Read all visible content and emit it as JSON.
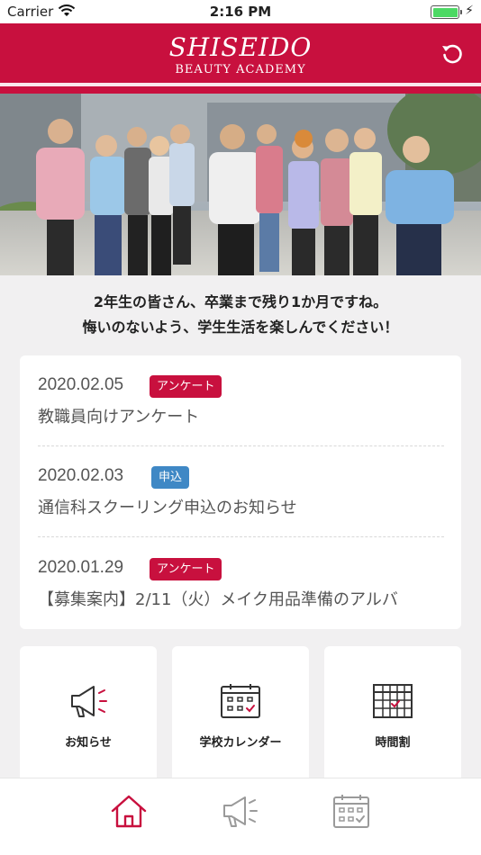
{
  "status_bar": {
    "carrier": "Carrier",
    "time": "2:16 PM"
  },
  "header": {
    "logo_brand": "SHISEIDO",
    "logo_sub": "BEAUTY ACADEMY",
    "refresh_icon": "refresh-icon",
    "brand_color": "#c8103e"
  },
  "hero": {
    "icon": "students-photo"
  },
  "message": {
    "line1": "2年生の皆さん、卒業まで残り1か月ですね。",
    "line2": "悔いのないよう、学生生活を楽しんでください！"
  },
  "news": [
    {
      "date": "2020.02.05",
      "tag": "アンケート",
      "tag_color": "#c8103e",
      "title": "教職員向けアンケート"
    },
    {
      "date": "2020.02.03",
      "tag": "申込",
      "tag_color": "#3f88c5",
      "title": "通信科スクーリング申込のお知らせ"
    },
    {
      "date": "2020.01.29",
      "tag": "アンケート",
      "tag_color": "#c8103e",
      "title": "【募集案内】2/11（火）メイク用品準備のアルバ"
    }
  ],
  "tiles": [
    {
      "label": "お知らせ",
      "icon": "megaphone-icon"
    },
    {
      "label": "学校カレンダー",
      "icon": "calendar-icon"
    },
    {
      "label": "時間割",
      "icon": "timetable-icon"
    }
  ],
  "tabbar": {
    "items": [
      {
        "icon": "home-icon",
        "active": true
      },
      {
        "icon": "megaphone-icon",
        "active": false
      },
      {
        "icon": "calendar-icon",
        "active": false
      }
    ],
    "active_color": "#c8103e",
    "inactive_color": "#9a9a9a"
  }
}
